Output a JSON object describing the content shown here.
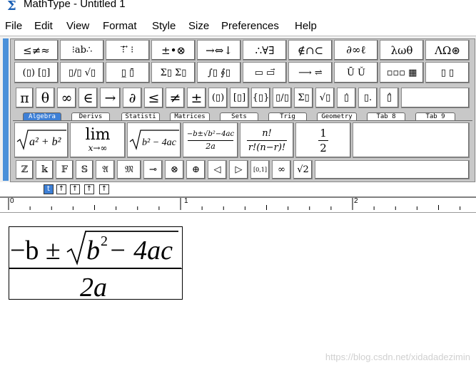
{
  "window": {
    "title": "MathType - Untitled 1",
    "icon": "sigma-icon"
  },
  "menu": [
    "File",
    "Edit",
    "View",
    "Format",
    "Style",
    "Size",
    "Preferences",
    "Help"
  ],
  "palette_row1": [
    "≤≠≈",
    "⁝ab∴",
    "⁝⃗ ⃗ ⁝",
    "±•⊗",
    "→⇔↓",
    "∴∀∃",
    "∉∩⊂",
    "∂∞ℓ",
    "λωθ",
    "ΛΩ⊛"
  ],
  "palette_row2": [
    "(▯) [▯]",
    "▯/▯ √▯",
    "▯̲ ▯̄",
    "Σ▯ Σ▯",
    "∫▯ ∮▯",
    "▭ ▭⃗",
    "⟶ ⇌",
    "Ū Ǔ",
    "▫▫▫ ▦",
    "▯ ▯"
  ],
  "symbol_bar": [
    "π",
    "θ",
    "∞",
    "∈",
    "→",
    "∂",
    "≤",
    "≠",
    "±",
    "(▯)",
    "[▯]",
    "{▯}",
    "▯/▯",
    "Σ▯",
    "√▯",
    "▯̇",
    "▯.",
    "▯̂"
  ],
  "tabs": [
    "Algebra",
    "Derivs",
    "Statisti",
    "Matrices",
    "Sets",
    "Trig",
    "Geometry",
    "Tab 8",
    "Tab 9"
  ],
  "templates": {
    "sqrt_sum": {
      "radicand": "a² + b²"
    },
    "limit": {
      "op": "lim",
      "sub": "x→∞"
    },
    "discriminant": {
      "radicand": "b² − 4ac"
    },
    "quadratic": {
      "numerator": "−b±√b²−4ac",
      "denominator": "2a"
    },
    "combination": {
      "numerator": "n!",
      "denominator": "r!(n−r)!"
    },
    "half": {
      "numerator": "1",
      "denominator": "2"
    }
  },
  "bottom_bar": [
    "ℤ",
    "𝕜",
    "𝔽",
    "𝕊",
    "𝔄",
    "𝔐",
    "⊸",
    "⊗",
    "⊕",
    "◁",
    "▷",
    "[0,1]",
    "∞",
    "√2"
  ],
  "format_toolbar": [
    "t",
    "↑",
    "↑",
    "↑",
    "↑"
  ],
  "ruler": {
    "marks": [
      "0",
      "1",
      "2"
    ]
  },
  "equation": {
    "numerator": {
      "prefix": "−b ± ",
      "radicand_base": "b",
      "exponent": "2",
      "rest": " − 4ac"
    },
    "denominator": "2a"
  },
  "watermark": "https://blog.csdn.net/xidadadezimin"
}
